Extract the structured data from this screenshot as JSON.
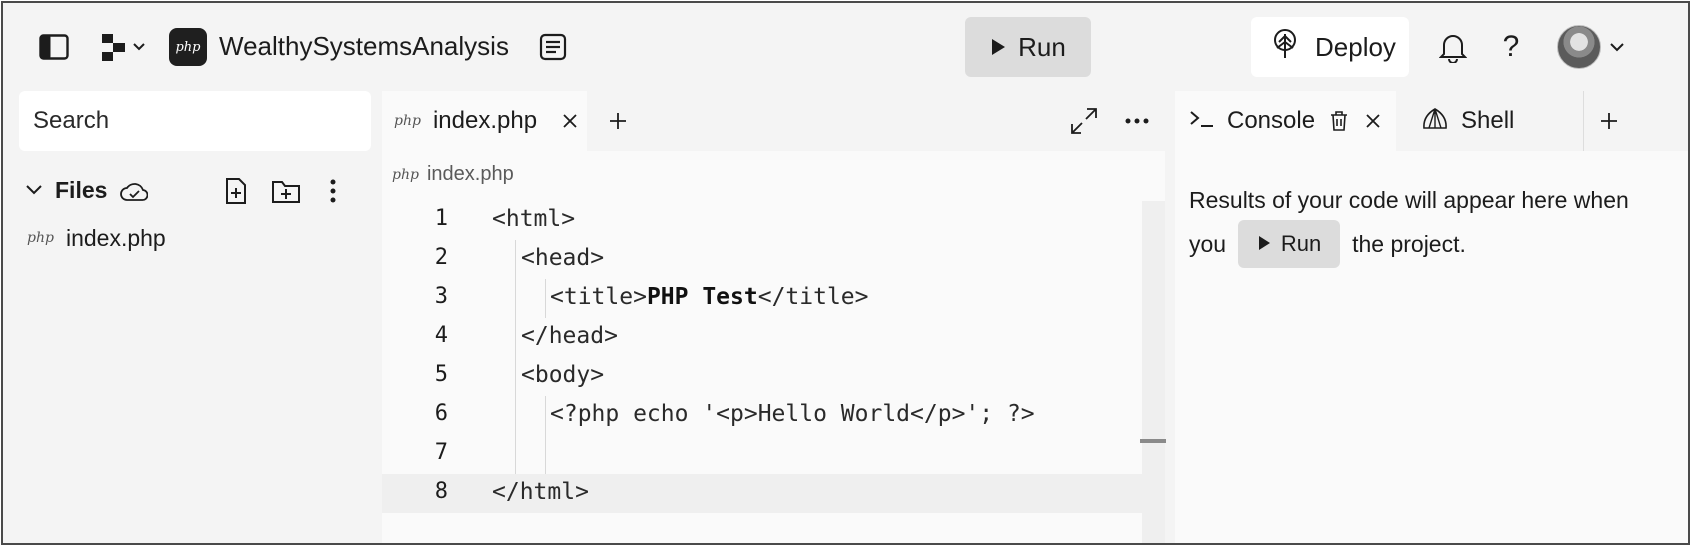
{
  "topbar": {
    "project_name": "WealthySystemsAnalysis",
    "language_badge": "php",
    "run_label": "Run",
    "deploy_label": "Deploy",
    "help_label": "?"
  },
  "sidebar": {
    "search_placeholder": "Search",
    "files_label": "Files",
    "files": [
      {
        "badge": "php",
        "name": "index.php"
      }
    ]
  },
  "editor": {
    "tab_badge": "php",
    "tab_name": "index.php",
    "breadcrumb_badge": "php",
    "breadcrumb": "index.php",
    "lines": [
      {
        "num": "1",
        "indent": 0,
        "text": "<html>"
      },
      {
        "num": "2",
        "indent": 1,
        "text": "<head>"
      },
      {
        "num": "3",
        "indent": 2,
        "pre": "<title>",
        "bold": "PHP Test",
        "post": "</title>"
      },
      {
        "num": "4",
        "indent": 1,
        "text": "</head>"
      },
      {
        "num": "5",
        "indent": 1,
        "text": "<body>"
      },
      {
        "num": "6",
        "indent": 2,
        "text": "<?php echo '<p>Hello World</p>'; ?>"
      },
      {
        "num": "7",
        "indent": 2,
        "text": ""
      },
      {
        "num": "8",
        "indent": 0,
        "text": "</html>"
      }
    ]
  },
  "right_panel": {
    "console_tab": "Console",
    "shell_tab": "Shell",
    "message_part1": "Results of your code will appear here when",
    "message_part2": "you",
    "inline_run": "Run",
    "message_part3": "the project."
  }
}
